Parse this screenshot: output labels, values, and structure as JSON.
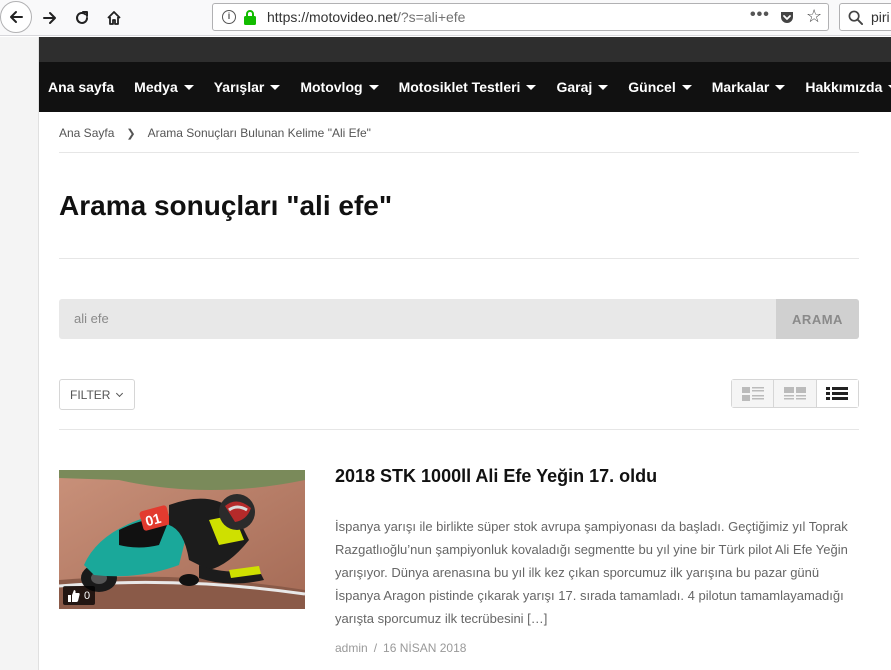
{
  "browser": {
    "url_host": "https://motovideo.net",
    "url_path": "/?s=ali+efe",
    "search_text": "piri"
  },
  "nav": {
    "items": [
      {
        "label": "Ana sayfa",
        "has_dropdown": false
      },
      {
        "label": "Medya",
        "has_dropdown": true
      },
      {
        "label": "Yarışlar",
        "has_dropdown": true
      },
      {
        "label": "Motovlog",
        "has_dropdown": true
      },
      {
        "label": "Motosiklet Testleri",
        "has_dropdown": true
      },
      {
        "label": "Garaj",
        "has_dropdown": true
      },
      {
        "label": "Güncel",
        "has_dropdown": true
      },
      {
        "label": "Markalar",
        "has_dropdown": true
      },
      {
        "label": "Hakkımızda",
        "has_dropdown": true
      }
    ]
  },
  "breadcrumb": {
    "home": "Ana Sayfa",
    "current": "Arama Sonuçları Bulunan Kelime \"Ali Efe\""
  },
  "page": {
    "title": "Arama sonuçları \"ali efe\""
  },
  "search": {
    "value": "ali efe",
    "button": "ARAMA"
  },
  "filter": {
    "label": "FILTER"
  },
  "post": {
    "title": "2018 STK 1000ll Ali Efe Yeğin 17. oldu",
    "excerpt": "İspanya yarışı ile birlikte süper stok avrupa şampiyonası da başladı. Geçtiğimiz yıl Toprak Razgatlıoğlu’nun şampiyonluk kovaladığı segmentte bu yıl yine bir Türk pilot Ali Efe Yeğin yarışıyor. Dünya arenasına bu yıl ilk kez çıkan sporcumuz ilk yarışına bu pazar günü İspanya Aragon pistinde çıkarak yarışı 17. sırada tamamladı. 4 pilotun tamamlayamadığı yarışta sporcumuz ilk tecrübesini […]",
    "likes": "0",
    "author": "admin",
    "separator": "/",
    "date": "16 NİSAN 2018"
  }
}
